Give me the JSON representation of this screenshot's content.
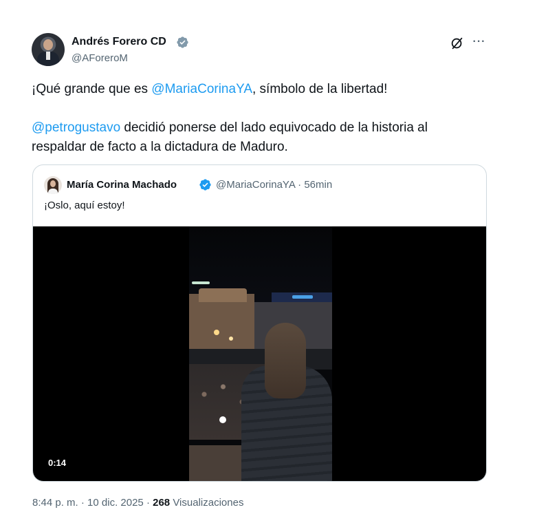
{
  "author": {
    "name": "Andrés Forero CD",
    "handle": "@AForeroM",
    "avatar_icon": "user-avatar",
    "verified_badge_color": "#829aab"
  },
  "tweet": {
    "line1": {
      "before": "¡Qué grande que es ",
      "mention": "@MariaCorinaYA",
      "after": ", símbolo de la libertad!"
    },
    "line2": {
      "mention": "@petrogustavo",
      "after": " decidió ponerse del lado equivocado de la historia al respaldar de facto a la dictadura de Maduro."
    }
  },
  "quoted_tweet": {
    "name": "María Corina Machado",
    "handle": "@MariaCorinaYA",
    "separator": "·",
    "time": "56min",
    "text": "¡Oslo, aquí estoy!",
    "verified_badge_color": "#1d9bf0",
    "video": {
      "duration": "0:14",
      "background": "#000000"
    }
  },
  "footer": {
    "time": "8:44 p. m.",
    "separator": "·",
    "date": "10 dic. 2025",
    "separator2": "·",
    "views_count": "268",
    "views_label": "Visualizaciones"
  },
  "icons": {
    "grok": "grok-icon",
    "more": "more-icon"
  },
  "colors": {
    "accent": "#1d9bf0",
    "text_primary": "#0f1419",
    "text_secondary": "#536471",
    "border": "#cfd9de"
  }
}
